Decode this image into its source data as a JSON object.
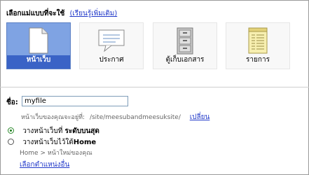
{
  "header": {
    "title": "เลือกแม่แบบที่จะใช้",
    "learn_more": "(เรียนรู้เพิ่มเติม)"
  },
  "templates": [
    {
      "label": "หน้าเว็บ",
      "icon": "blank-page-icon",
      "selected": true
    },
    {
      "label": "ประกาศ",
      "icon": "speech-bubble-icon",
      "selected": false
    },
    {
      "label": "ตู้เก็บเอกสาร",
      "icon": "file-cabinet-icon",
      "selected": false
    },
    {
      "label": "รายการ",
      "icon": "list-page-icon",
      "selected": false
    }
  ],
  "name_field": {
    "label": "ชื่อ:",
    "value": "myfile"
  },
  "url_info": {
    "prefix": "หน้าเว็บของคุณจะอยู่ที่:",
    "path": "/site/meesubandmeesuksite/",
    "change_link": "เปลี่ยน"
  },
  "placement": {
    "option_top": {
      "prefix": "วางหน้าเว็บที่",
      "bold": "ระดับบนสุด",
      "checked": true
    },
    "option_under": {
      "prefix": "วางหน้าเว็บไว้ใต้",
      "bold": "Home",
      "checked": false
    },
    "breadcrumb": "Home > หน้าใหม่ของคุณ",
    "choose_other": "เลือกตำแหน่งอื่น"
  },
  "colors": {
    "selected_card_bg": "#7fa3e3",
    "selected_label_bar": "#3a63c6",
    "link": "#1f37c9"
  }
}
